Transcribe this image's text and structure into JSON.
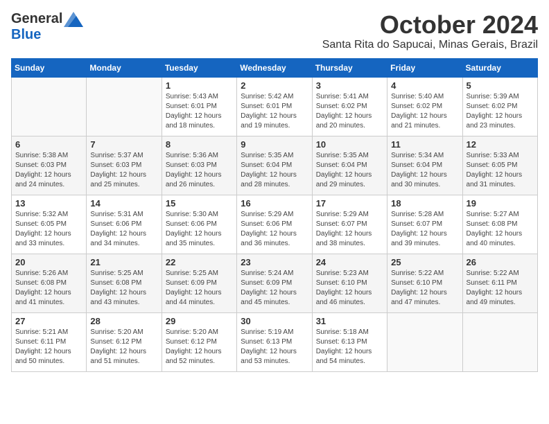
{
  "logo": {
    "general": "General",
    "blue": "Blue"
  },
  "title": "October 2024",
  "location": "Santa Rita do Sapucai, Minas Gerais, Brazil",
  "weekdays": [
    "Sunday",
    "Monday",
    "Tuesday",
    "Wednesday",
    "Thursday",
    "Friday",
    "Saturday"
  ],
  "weeks": [
    [
      {
        "day": "",
        "info": ""
      },
      {
        "day": "",
        "info": ""
      },
      {
        "day": "1",
        "info": "Sunrise: 5:43 AM\nSunset: 6:01 PM\nDaylight: 12 hours and 18 minutes."
      },
      {
        "day": "2",
        "info": "Sunrise: 5:42 AM\nSunset: 6:01 PM\nDaylight: 12 hours and 19 minutes."
      },
      {
        "day": "3",
        "info": "Sunrise: 5:41 AM\nSunset: 6:02 PM\nDaylight: 12 hours and 20 minutes."
      },
      {
        "day": "4",
        "info": "Sunrise: 5:40 AM\nSunset: 6:02 PM\nDaylight: 12 hours and 21 minutes."
      },
      {
        "day": "5",
        "info": "Sunrise: 5:39 AM\nSunset: 6:02 PM\nDaylight: 12 hours and 23 minutes."
      }
    ],
    [
      {
        "day": "6",
        "info": "Sunrise: 5:38 AM\nSunset: 6:03 PM\nDaylight: 12 hours and 24 minutes."
      },
      {
        "day": "7",
        "info": "Sunrise: 5:37 AM\nSunset: 6:03 PM\nDaylight: 12 hours and 25 minutes."
      },
      {
        "day": "8",
        "info": "Sunrise: 5:36 AM\nSunset: 6:03 PM\nDaylight: 12 hours and 26 minutes."
      },
      {
        "day": "9",
        "info": "Sunrise: 5:35 AM\nSunset: 6:04 PM\nDaylight: 12 hours and 28 minutes."
      },
      {
        "day": "10",
        "info": "Sunrise: 5:35 AM\nSunset: 6:04 PM\nDaylight: 12 hours and 29 minutes."
      },
      {
        "day": "11",
        "info": "Sunrise: 5:34 AM\nSunset: 6:04 PM\nDaylight: 12 hours and 30 minutes."
      },
      {
        "day": "12",
        "info": "Sunrise: 5:33 AM\nSunset: 6:05 PM\nDaylight: 12 hours and 31 minutes."
      }
    ],
    [
      {
        "day": "13",
        "info": "Sunrise: 5:32 AM\nSunset: 6:05 PM\nDaylight: 12 hours and 33 minutes."
      },
      {
        "day": "14",
        "info": "Sunrise: 5:31 AM\nSunset: 6:06 PM\nDaylight: 12 hours and 34 minutes."
      },
      {
        "day": "15",
        "info": "Sunrise: 5:30 AM\nSunset: 6:06 PM\nDaylight: 12 hours and 35 minutes."
      },
      {
        "day": "16",
        "info": "Sunrise: 5:29 AM\nSunset: 6:06 PM\nDaylight: 12 hours and 36 minutes."
      },
      {
        "day": "17",
        "info": "Sunrise: 5:29 AM\nSunset: 6:07 PM\nDaylight: 12 hours and 38 minutes."
      },
      {
        "day": "18",
        "info": "Sunrise: 5:28 AM\nSunset: 6:07 PM\nDaylight: 12 hours and 39 minutes."
      },
      {
        "day": "19",
        "info": "Sunrise: 5:27 AM\nSunset: 6:08 PM\nDaylight: 12 hours and 40 minutes."
      }
    ],
    [
      {
        "day": "20",
        "info": "Sunrise: 5:26 AM\nSunset: 6:08 PM\nDaylight: 12 hours and 41 minutes."
      },
      {
        "day": "21",
        "info": "Sunrise: 5:25 AM\nSunset: 6:08 PM\nDaylight: 12 hours and 43 minutes."
      },
      {
        "day": "22",
        "info": "Sunrise: 5:25 AM\nSunset: 6:09 PM\nDaylight: 12 hours and 44 minutes."
      },
      {
        "day": "23",
        "info": "Sunrise: 5:24 AM\nSunset: 6:09 PM\nDaylight: 12 hours and 45 minutes."
      },
      {
        "day": "24",
        "info": "Sunrise: 5:23 AM\nSunset: 6:10 PM\nDaylight: 12 hours and 46 minutes."
      },
      {
        "day": "25",
        "info": "Sunrise: 5:22 AM\nSunset: 6:10 PM\nDaylight: 12 hours and 47 minutes."
      },
      {
        "day": "26",
        "info": "Sunrise: 5:22 AM\nSunset: 6:11 PM\nDaylight: 12 hours and 49 minutes."
      }
    ],
    [
      {
        "day": "27",
        "info": "Sunrise: 5:21 AM\nSunset: 6:11 PM\nDaylight: 12 hours and 50 minutes."
      },
      {
        "day": "28",
        "info": "Sunrise: 5:20 AM\nSunset: 6:12 PM\nDaylight: 12 hours and 51 minutes."
      },
      {
        "day": "29",
        "info": "Sunrise: 5:20 AM\nSunset: 6:12 PM\nDaylight: 12 hours and 52 minutes."
      },
      {
        "day": "30",
        "info": "Sunrise: 5:19 AM\nSunset: 6:13 PM\nDaylight: 12 hours and 53 minutes."
      },
      {
        "day": "31",
        "info": "Sunrise: 5:18 AM\nSunset: 6:13 PM\nDaylight: 12 hours and 54 minutes."
      },
      {
        "day": "",
        "info": ""
      },
      {
        "day": "",
        "info": ""
      }
    ]
  ]
}
